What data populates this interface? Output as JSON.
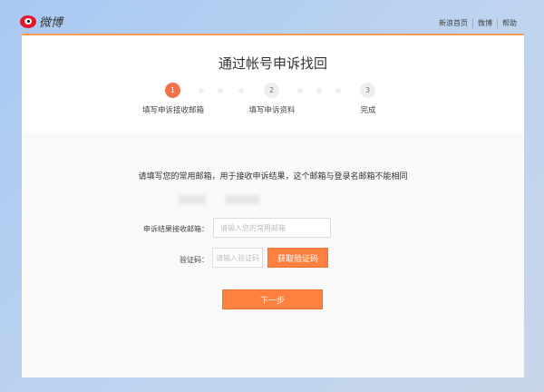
{
  "header": {
    "logo": "微博",
    "nav": [
      "新浪首页",
      "微博",
      "帮助"
    ]
  },
  "title": "通过帐号申诉找回",
  "steps": [
    {
      "num": "1",
      "label": "填写申诉接收邮箱"
    },
    {
      "num": "2",
      "label": "填写申诉资料"
    },
    {
      "num": "3",
      "label": "完成"
    }
  ],
  "form": {
    "instruction": "请填写您的常用邮箱，用于接收申诉结果，这个邮箱与登录名邮箱不能相同",
    "email_label": "申诉结果接收邮箱：",
    "email_placeholder": "请输入您的常用邮箱",
    "code_label": "验证码：",
    "code_placeholder": "请输入验证码",
    "get_code": "获取验证码",
    "next": "下一步"
  },
  "colors": {
    "accent": "#ff8140",
    "step_active": "#f0734a"
  }
}
